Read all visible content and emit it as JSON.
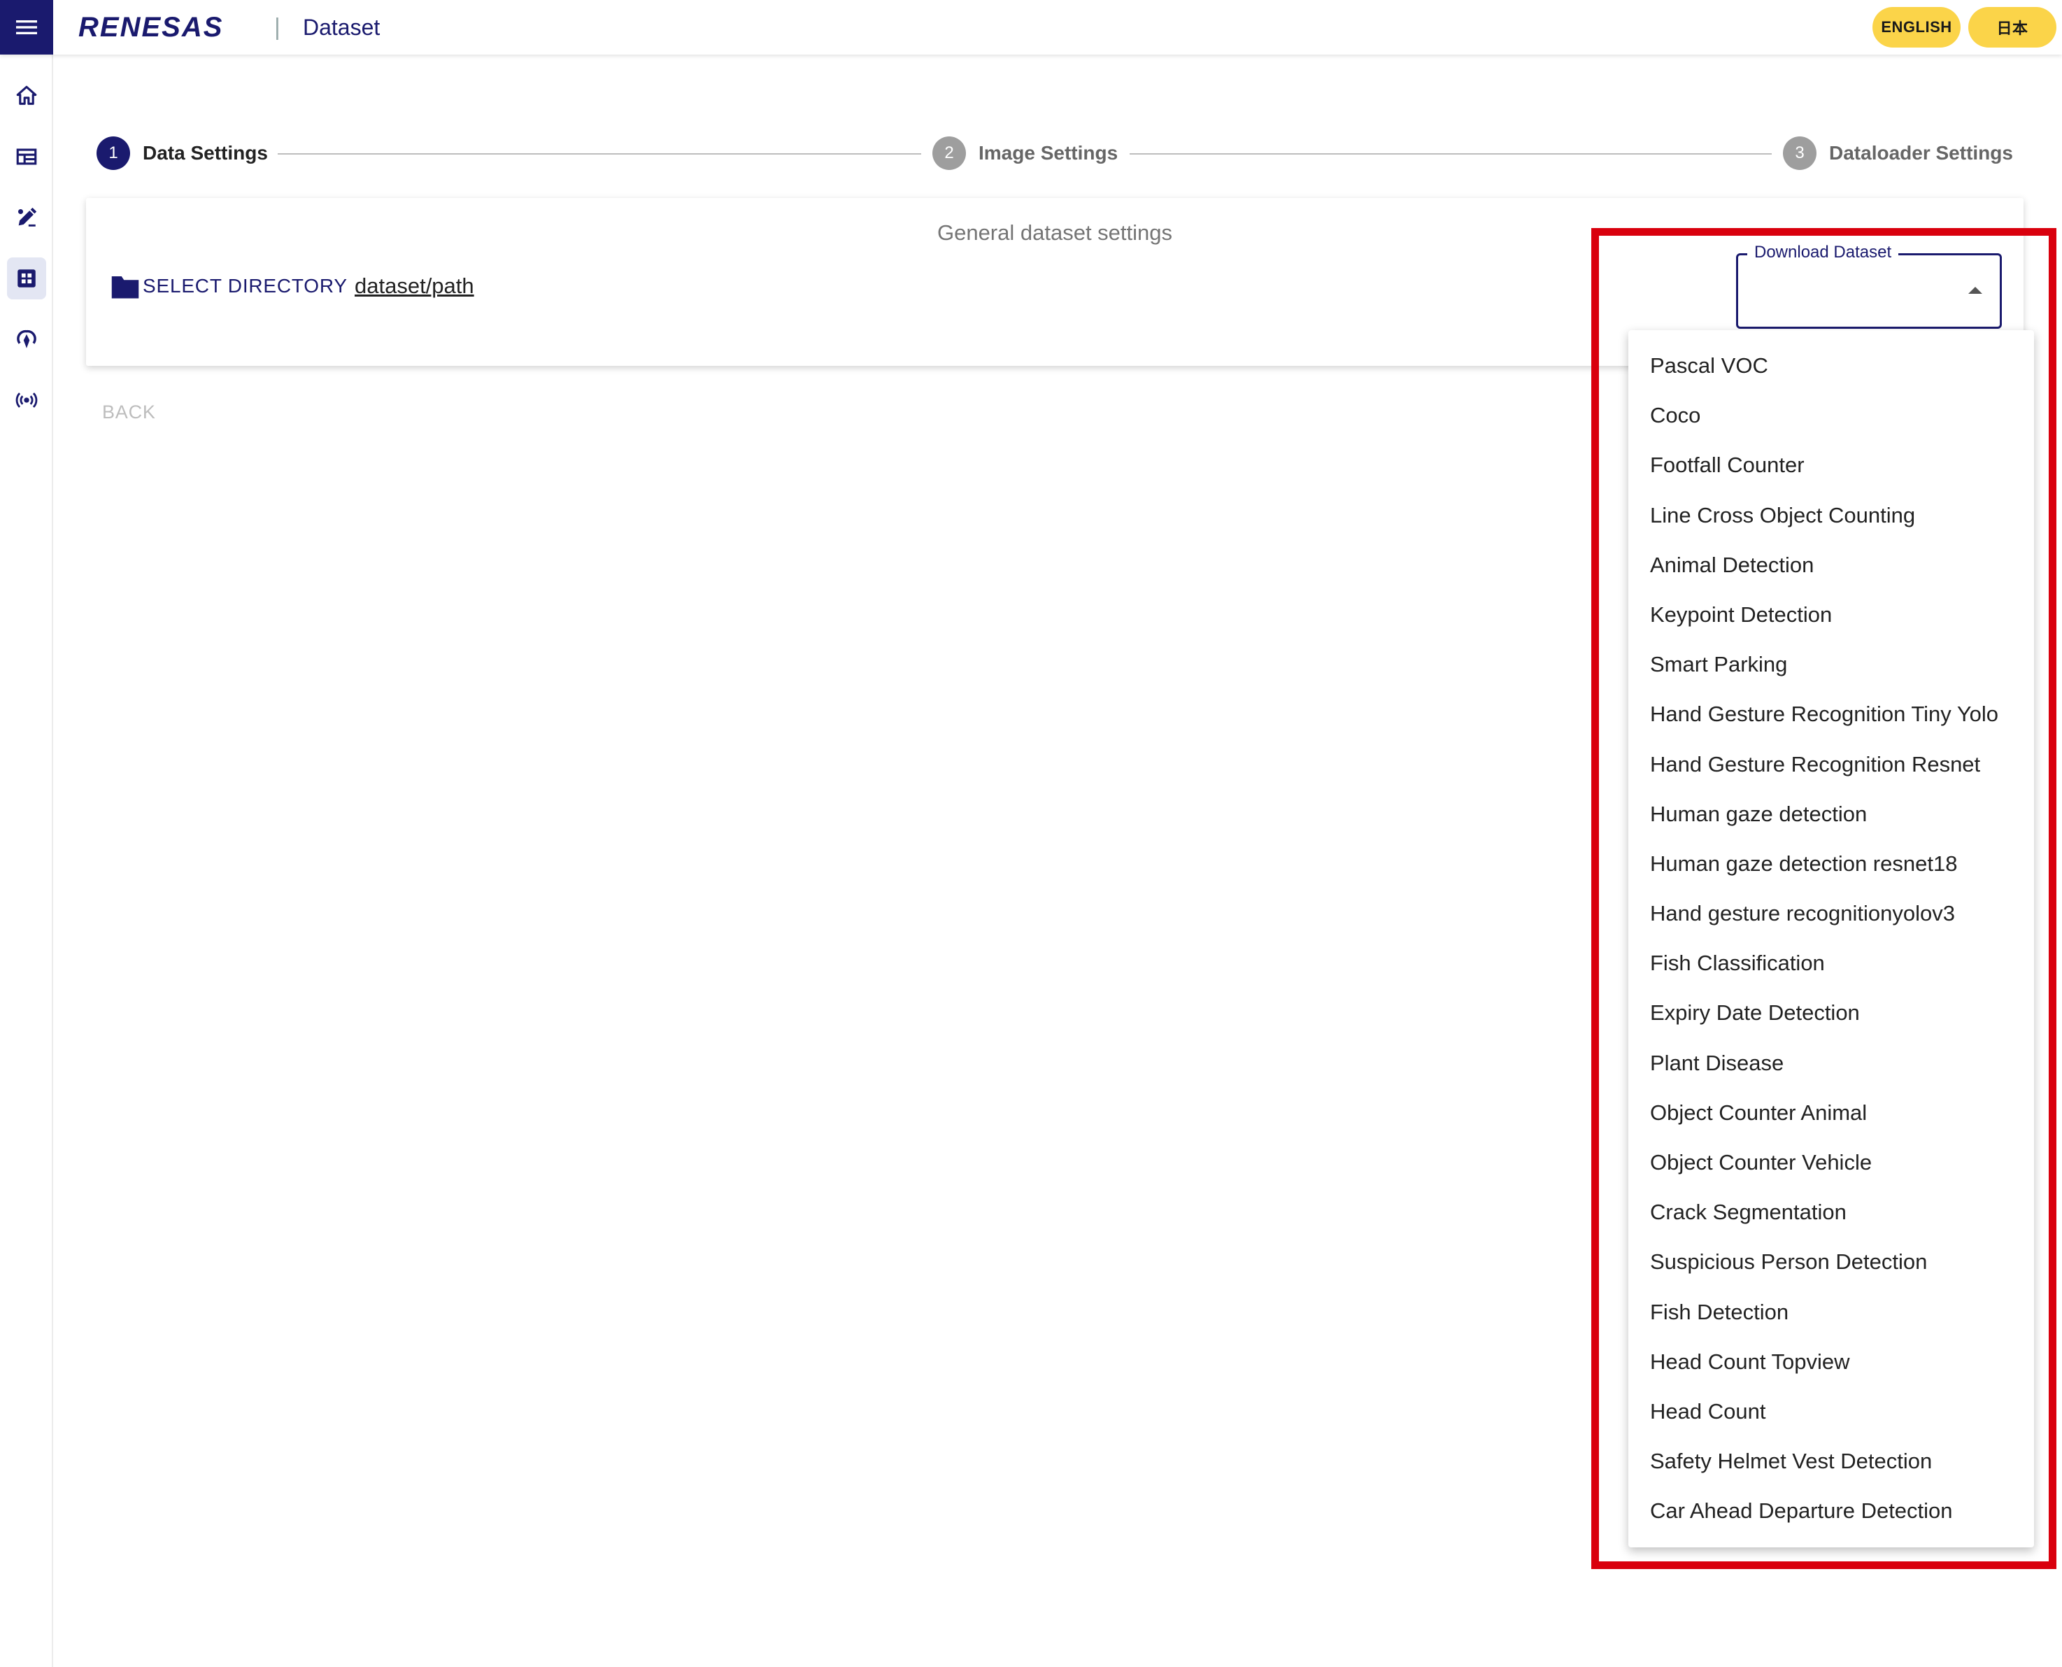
{
  "header": {
    "brand": "RENESAS",
    "separator": "|",
    "title": "Dataset",
    "languages": [
      "ENGLISH",
      "日本"
    ]
  },
  "sidebar": {
    "items": [
      {
        "icon": "home-icon"
      },
      {
        "icon": "dashboard-icon"
      },
      {
        "icon": "annotate-icon"
      },
      {
        "icon": "dataset-icon",
        "active": true
      },
      {
        "icon": "training-icon"
      },
      {
        "icon": "broadcast-icon"
      }
    ]
  },
  "stepper": {
    "steps": [
      {
        "number": "1",
        "label": "Data Settings",
        "active": true
      },
      {
        "number": "2",
        "label": "Image Settings",
        "active": false
      },
      {
        "number": "3",
        "label": "Dataloader Settings",
        "active": false
      }
    ]
  },
  "card": {
    "heading": "General dataset settings",
    "select_directory_label": "SELECT DIRECTORY",
    "directory_path": "dataset/path",
    "download_label": "Download Dataset"
  },
  "back_label": "BACK",
  "dropdown": {
    "options": [
      "Pascal VOC",
      "Coco",
      "Footfall Counter",
      "Line Cross Object Counting",
      "Animal Detection",
      "Keypoint Detection",
      "Smart Parking",
      "Hand Gesture Recognition Tiny Yolo",
      "Hand Gesture Recognition Resnet",
      "Human gaze detection",
      "Human gaze detection resnet18",
      "Hand gesture recognitionyolov3",
      "Fish Classification",
      "Expiry Date Detection",
      "Plant Disease",
      "Object Counter Animal",
      "Object Counter Vehicle",
      "Crack Segmentation",
      "Suspicious Person Detection",
      "Fish Detection",
      "Head Count Topview",
      "Head Count",
      "Safety Helmet Vest Detection",
      "Car Ahead Departure Detection"
    ]
  },
  "colors": {
    "brand": "#1a1a6e",
    "accent_yellow": "#fbd449",
    "highlight_red": "#d9000d"
  }
}
